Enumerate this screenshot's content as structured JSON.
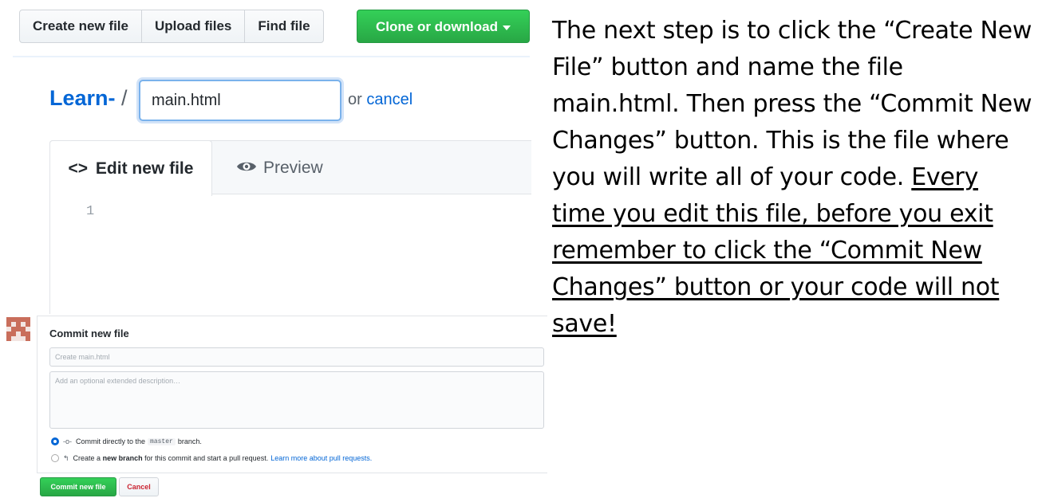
{
  "toolbar": {
    "create_new_file": "Create new file",
    "upload_files": "Upload files",
    "find_file": "Find file",
    "clone_or_download": "Clone or download"
  },
  "filename_row": {
    "repo": "Learn-",
    "separator": "/",
    "filename_value": "main.html",
    "or_text": "or",
    "cancel": "cancel"
  },
  "editor": {
    "tab_edit_icon": "<>",
    "tab_edit_label": "Edit new file",
    "tab_preview_label": "Preview",
    "line_number": "1"
  },
  "commit": {
    "title": "Commit new file",
    "message_placeholder": "Create main.html",
    "description_placeholder": "Add an optional extended description…",
    "option_direct_pre": "Commit directly to the",
    "option_direct_branch": "master",
    "option_direct_post": "branch.",
    "option_new_pre": "Create a",
    "option_new_bold": "new branch",
    "option_new_post": "for this commit and start a pull request.",
    "option_new_link": "Learn more about pull requests.",
    "submit_label": "Commit new file",
    "cancel_label": "Cancel"
  },
  "instructions": {
    "plain": "The next step is to click the “Create New File” button and name the file main.html.  Then press the “Commit New Changes” button.  This is the file where you will write all of your code.",
    "underlined": "Every time you edit this file, before you exit remember to click the “Commit New Changes” button or your code will not save!"
  },
  "colors": {
    "link_blue": "#0366d6",
    "primary_green": "#28a745",
    "danger_red": "#cb2431"
  },
  "icons": [
    "code-icon",
    "eye-icon",
    "avatar",
    "radio-checked",
    "radio-unchecked",
    "commit-icon",
    "pull-request-icon",
    "caret-down-icon"
  ]
}
